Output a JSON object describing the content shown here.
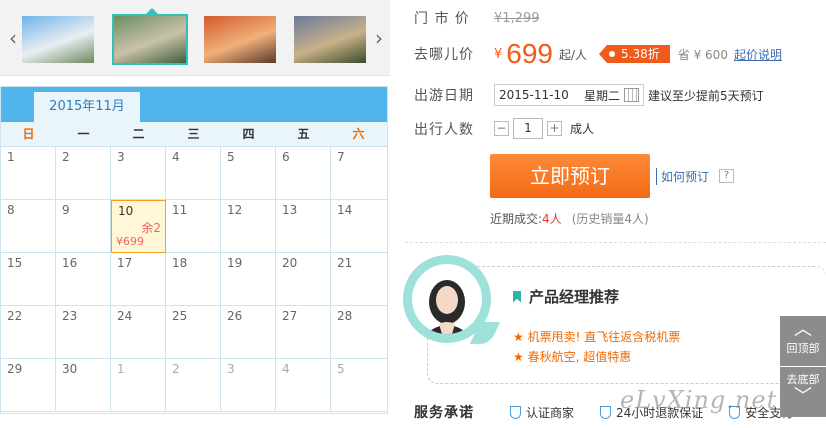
{
  "thumbs": {
    "prev_icon": "‹",
    "next_icon": "›",
    "items": [
      {
        "colors": [
          "#6fb3e8",
          "#e9eef4",
          "#6d8a5a"
        ]
      },
      {
        "colors": [
          "#6c8e63",
          "#c9c2a8",
          "#3e5d3b"
        ]
      },
      {
        "colors": [
          "#d45a2c",
          "#f0b07a",
          "#5a3a2a"
        ]
      },
      {
        "colors": [
          "#6a7a9a",
          "#c9b18a",
          "#3b4b2a"
        ]
      }
    ]
  },
  "calendar": {
    "month": "2015年11月",
    "weekdays": [
      "日",
      "一",
      "二",
      "三",
      "四",
      "五",
      "六"
    ],
    "weeks": [
      [
        "1",
        "2",
        "3",
        "4",
        "5",
        "6",
        "7"
      ],
      [
        "8",
        "9",
        "10",
        "11",
        "12",
        "13",
        "14"
      ],
      [
        "15",
        "16",
        "17",
        "18",
        "19",
        "20",
        "21"
      ],
      [
        "22",
        "23",
        "24",
        "25",
        "26",
        "27",
        "28"
      ],
      [
        "29",
        "30",
        "1",
        "2",
        "3",
        "4",
        "5"
      ]
    ],
    "selected": {
      "day": "10",
      "remaining": "余2",
      "price": "¥699"
    }
  },
  "product": {
    "market_label": "门 市 价",
    "market_price": "¥1,299",
    "qunar_label": "去哪儿价",
    "yen": "¥",
    "price": "699",
    "price_unit": "起/人",
    "discount": "5.38折",
    "save_text": "省 ¥ 600",
    "start_note_link": "起价说明",
    "date_label": "出游日期",
    "date_value": "2015-11-10",
    "date_weekday": "星期二",
    "date_hint": "建议至少提前5天预订",
    "people_label": "出行人数",
    "qty_minus": "−",
    "qty_value": "1",
    "qty_plus": "+",
    "qty_unit": "成人",
    "book_button": "立即预订",
    "how_to_book": "如何预订",
    "help_icon": "?",
    "recent_label": "近期成交:",
    "recent_count": "4人",
    "history": "(历史销量4人)"
  },
  "recommend": {
    "title": "产品经理推荐",
    "items": [
      "★ 机票甩卖! 直飞往返含税机票",
      "★ 春秋航空, 超值特惠"
    ]
  },
  "promise": {
    "label": "服务承诺",
    "items": [
      "认证商家",
      "24小时退款保证",
      "安全支付"
    ]
  },
  "side_tools": {
    "top_label": "回顶部",
    "bottom_label": "去底部"
  },
  "watermark": "eLvXing.net"
}
